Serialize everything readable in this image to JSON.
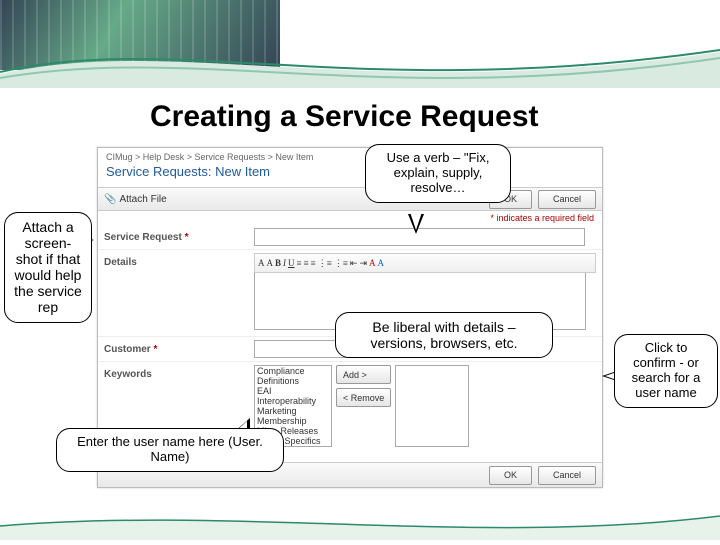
{
  "slide_title": "Creating a Service Request",
  "breadcrumbs": "CIMug > Help Desk > Service Requests > New Item",
  "page_heading": "Service Requests: New Item",
  "toolbar": {
    "attach_label": "Attach File",
    "ok_label": "OK",
    "cancel_label": "Cancel",
    "required_note": "* indicates a required field"
  },
  "fields": {
    "service_request": {
      "label": "Service Request",
      "value": ""
    },
    "details": {
      "label": "Details",
      "value": ""
    },
    "customer": {
      "label": "Customer",
      "value": ""
    },
    "keywords": {
      "label": "Keywords",
      "options": [
        "Compliance",
        "Definitions",
        "EAI",
        "Interoperability",
        "Marketing",
        "Membership",
        "Misc. Releases",
        "Mode. Specifics"
      ],
      "add_label": "Add >",
      "remove_label": "< Remove"
    }
  },
  "rte_icons": [
    "A",
    "A",
    "B",
    "I",
    "U",
    "≡",
    "≡",
    "≡",
    "⚑",
    "⋮",
    "⋮",
    "A",
    "—"
  ],
  "callouts": {
    "attach": "Attach a screen-shot if that would help the service rep",
    "verb": "Use a verb – \"Fix, explain, supply, resolve…",
    "details": "Be liberal with details – versions, browsers, etc.",
    "confirm": "Click to confirm - or search for a user name",
    "username": "Enter the user name here (User. Name)"
  },
  "bottom": {
    "ok_label": "OK",
    "cancel_label": "Cancel"
  }
}
